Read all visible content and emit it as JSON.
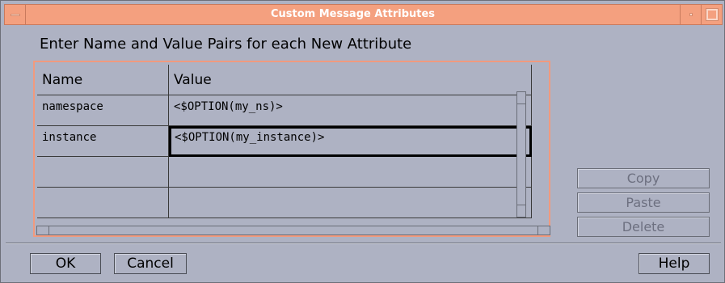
{
  "window": {
    "title": "Custom Message Attributes"
  },
  "instruction": "Enter Name and Value Pairs for each New Attribute",
  "table": {
    "columns": [
      "Name",
      "Value"
    ],
    "rows": [
      {
        "name": "namespace",
        "value": "<$OPTION(my_ns)>"
      },
      {
        "name": "instance",
        "value": "<$OPTION(my_instance)>"
      },
      {
        "name": "",
        "value": ""
      },
      {
        "name": "",
        "value": ""
      }
    ]
  },
  "side_buttons": {
    "copy": "Copy",
    "paste": "Paste",
    "delete": "Delete"
  },
  "footer": {
    "ok": "OK",
    "cancel": "Cancel",
    "help": "Help"
  }
}
